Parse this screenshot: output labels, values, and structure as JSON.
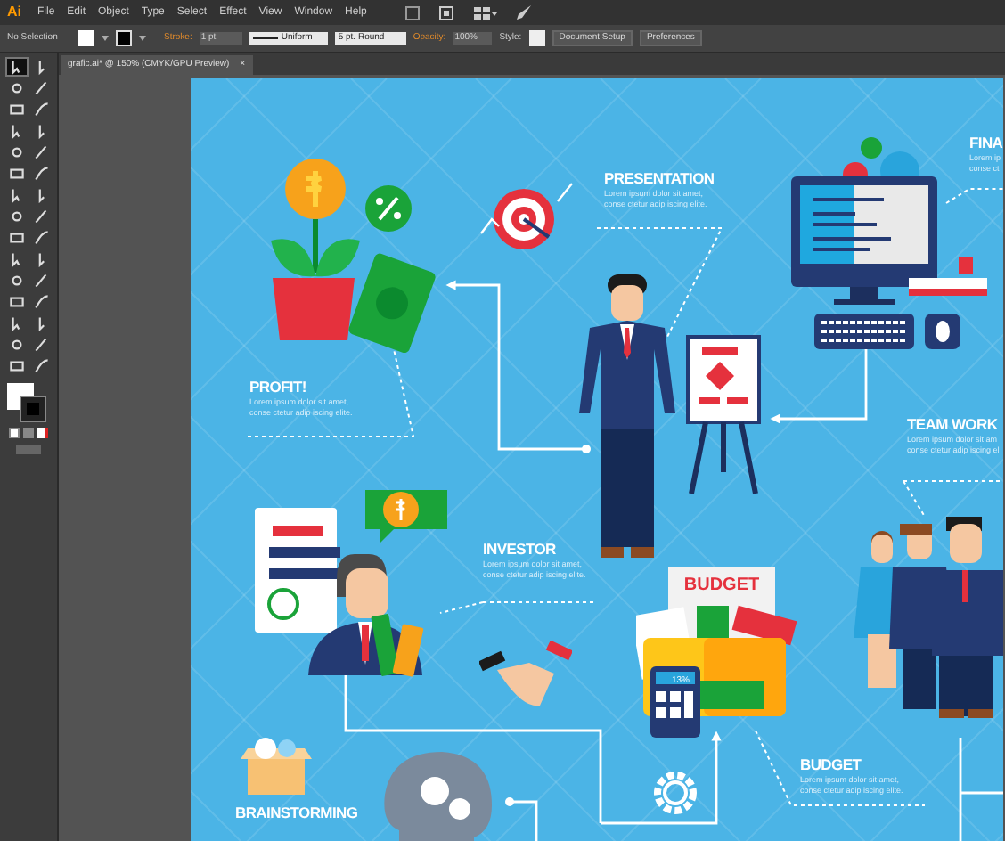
{
  "app_logo": "Ai",
  "menu": [
    "File",
    "Edit",
    "Object",
    "Type",
    "Select",
    "Effect",
    "View",
    "Window",
    "Help"
  ],
  "control_bar": {
    "selection": "No Selection",
    "stroke_label": "Stroke:",
    "stroke_weight": "1 pt",
    "profile": "Uniform",
    "brush": "5 pt. Round",
    "opacity_label": "Opacity:",
    "opacity": "100%",
    "style_label": "Style:",
    "buttons": [
      "Document Setup",
      "Preferences"
    ]
  },
  "document_tab": {
    "title": "grafic.ai* @ 150% (CMYK/GPU Preview)",
    "close": "×"
  },
  "tools": [
    {
      "selected": true
    },
    {
      "selected": false
    },
    {
      "selected": false
    },
    {
      "selected": false
    },
    {
      "selected": false
    },
    {
      "selected": false
    },
    {
      "selected": false
    },
    {
      "selected": false
    },
    {
      "selected": false
    },
    {
      "selected": false
    },
    {
      "selected": false
    },
    {
      "selected": false
    },
    {
      "selected": false
    },
    {
      "selected": false
    },
    {
      "selected": false
    },
    {
      "selected": false
    },
    {
      "selected": false
    },
    {
      "selected": false
    },
    {
      "selected": false
    },
    {
      "selected": false
    },
    {
      "selected": false
    },
    {
      "selected": false
    },
    {
      "selected": false
    },
    {
      "selected": false
    },
    {
      "selected": false
    },
    {
      "selected": false
    },
    {
      "selected": false
    },
    {
      "selected": false
    },
    {
      "selected": false
    },
    {
      "selected": false
    }
  ],
  "sections": [
    {
      "kind": "presentation",
      "title": "PRESENTATION",
      "lines": [
        "Lorem ipsum dolor sit amet,",
        "conse ctetur adip iscing elite."
      ]
    },
    {
      "kind": "final",
      "title": "FINA",
      "lines": [
        "Lorem ip",
        "conse ct"
      ]
    },
    {
      "kind": "profit",
      "title": "PROFIT!",
      "lines": [
        "Lorem ipsum dolor sit amet,",
        "conse ctetur adip iscing elite."
      ]
    },
    {
      "kind": "team",
      "title": "TEAM WORK",
      "lines": [
        "Lorem ipsum dolor sit am",
        "conse ctetur adip iscing el"
      ]
    },
    {
      "kind": "investor",
      "title": "INVESTOR",
      "lines": [
        "Lorem ipsum dolor sit amet,",
        "conse ctetur adip iscing elite."
      ]
    },
    {
      "kind": "budget",
      "title": "BUDGET",
      "lines": [
        "Lorem ipsum dolor sit amet,",
        "conse ctetur adip iscing elite."
      ]
    },
    {
      "kind": "brainstorming",
      "title": "BRAINSTORMING"
    }
  ],
  "budget_sheet": {
    "title": "BUDGET",
    "calculator": "13%"
  }
}
